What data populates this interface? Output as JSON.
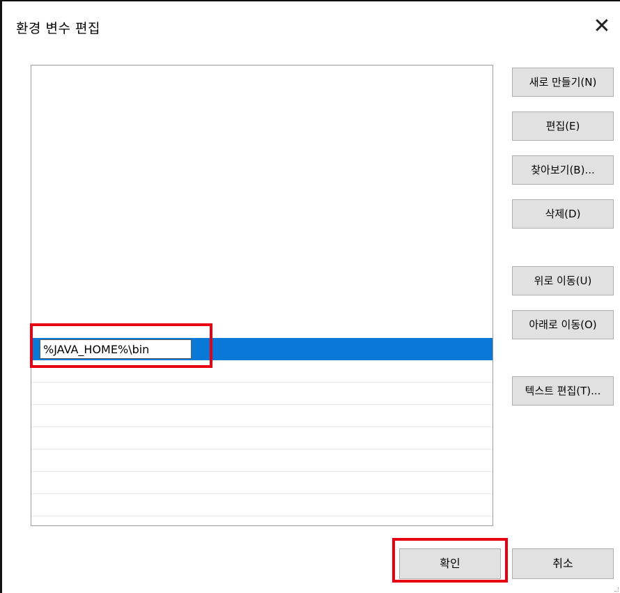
{
  "window": {
    "title": "환경 변수 편집",
    "close_glyph": "✕"
  },
  "list": {
    "selected_index": 0,
    "edit_value": "%JAVA_HOME%\\bin",
    "selection_color": "#0a78d7"
  },
  "side_buttons": {
    "new": "새로 만들기(N)",
    "edit": "편집(E)",
    "browse": "찾아보기(B)...",
    "delete": "삭제(D)",
    "move_up": "위로 이동(U)",
    "move_down": "아래로 이동(O)",
    "edit_text": "텍스트 편집(T)..."
  },
  "bottom_buttons": {
    "ok": "확인",
    "cancel": "취소"
  },
  "annotation": {
    "highlight_color": "#e60012"
  },
  "icons": {
    "close": "close-icon"
  }
}
